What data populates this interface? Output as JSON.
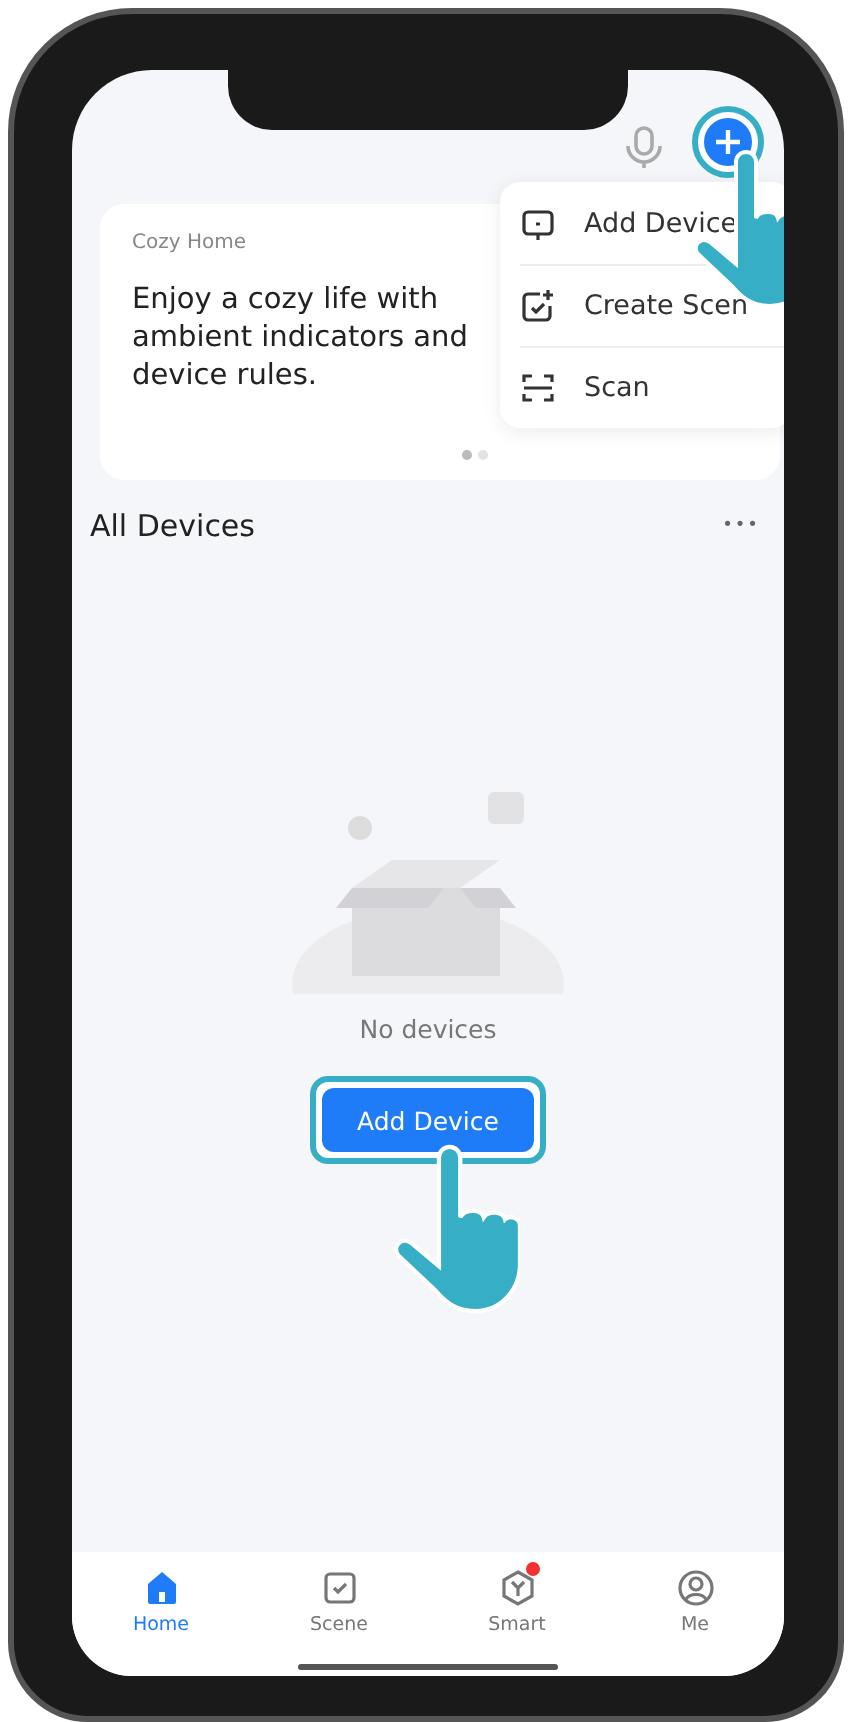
{
  "top_bar": {
    "plus_highlighted": true
  },
  "banner": {
    "caption": "Cozy Home",
    "message": "Enjoy a cozy life with ambient indicators and device rules.",
    "pages": [
      {
        "selected": true
      },
      {
        "selected": false
      }
    ]
  },
  "menu": {
    "items": [
      {
        "kind": "device",
        "label": "Add Device"
      },
      {
        "kind": "scene",
        "label": "Create Scen"
      },
      {
        "kind": "scan",
        "label": "Scan"
      }
    ]
  },
  "section": {
    "title": "All Devices",
    "more": "•••"
  },
  "empty_state": {
    "message": "No devices",
    "button": "Add Device",
    "button_highlighted": true
  },
  "tabs": [
    {
      "kind": "home",
      "label": "Home",
      "selected": true,
      "badge": false
    },
    {
      "kind": "scene",
      "label": "Scene",
      "selected": false,
      "badge": false
    },
    {
      "kind": "smart",
      "label": "Smart",
      "selected": false,
      "badge": true
    },
    {
      "kind": "me",
      "label": "Me",
      "selected": false,
      "badge": false
    }
  ]
}
